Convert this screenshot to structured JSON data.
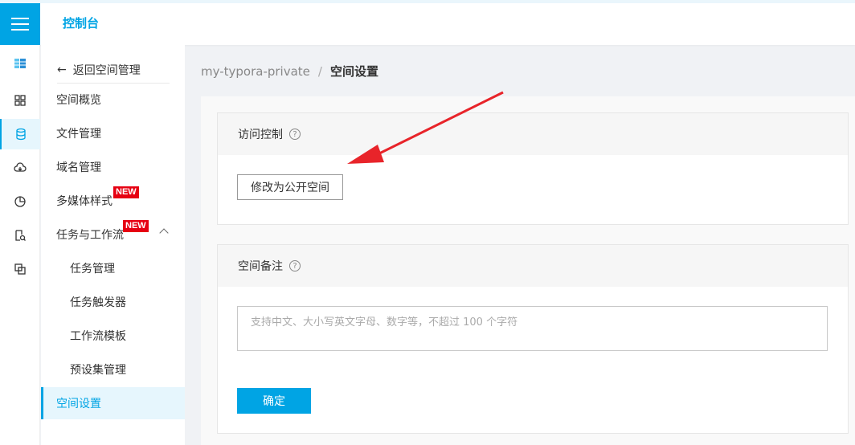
{
  "topbar": {
    "title": "控制台"
  },
  "rail": {
    "icons": [
      "bucket-icon",
      "grid-icon",
      "database-icon",
      "cloud-icon",
      "pie-chart-icon",
      "document-search-icon",
      "image-process-icon"
    ]
  },
  "sidenav": {
    "back": "返回空间管理",
    "items": [
      {
        "label": "空间概览"
      },
      {
        "label": "文件管理"
      },
      {
        "label": "域名管理"
      },
      {
        "label": "多媒体样式",
        "badge": "NEW"
      },
      {
        "label": "任务与工作流",
        "badge": "NEW"
      },
      {
        "label": "任务管理"
      },
      {
        "label": "任务触发器"
      },
      {
        "label": "工作流模板"
      },
      {
        "label": "预设集管理"
      },
      {
        "label": "空间设置"
      }
    ]
  },
  "breadcrumb": {
    "bucket": "my-typora-private",
    "sep": "/",
    "current": "空间设置"
  },
  "access_card": {
    "title": "访问控制",
    "help": "?",
    "button": "修改为公开空间"
  },
  "remark_card": {
    "title": "空间备注",
    "help": "?",
    "placeholder": "支持中文、大小写英文字母、数字等，不超过 100 个字符",
    "confirm": "确定"
  },
  "colors": {
    "accent": "#00a4e4",
    "badge": "#e60012",
    "arrow": "#e8242a"
  }
}
